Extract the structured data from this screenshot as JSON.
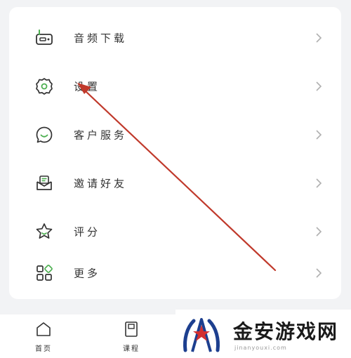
{
  "menu": {
    "items": [
      {
        "label": "音频下载",
        "icon": "radio-icon"
      },
      {
        "label": "设置",
        "icon": "gear-icon"
      },
      {
        "label": "客户服务",
        "icon": "chat-smile-icon"
      },
      {
        "label": "邀请好友",
        "icon": "envelope-icon"
      },
      {
        "label": "评分",
        "icon": "star-icon"
      },
      {
        "label": "更多",
        "icon": "grid-icon"
      }
    ]
  },
  "tabbar": {
    "tabs": [
      {
        "label": "首页",
        "icon": "home-icon"
      },
      {
        "label": "课程",
        "icon": "book-icon"
      }
    ]
  },
  "watermark": {
    "text": "金安游戏网",
    "url": "jinanyouxi.com"
  },
  "colors": {
    "icon_stroke": "#333333",
    "icon_accent": "#4caf50",
    "arrow": "#c0392b",
    "chevron": "#b0b0b0"
  }
}
